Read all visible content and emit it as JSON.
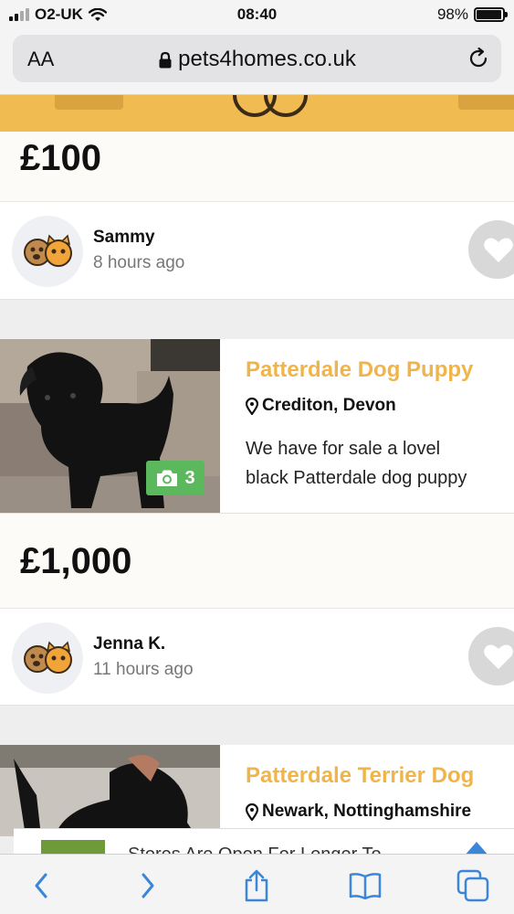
{
  "status_bar": {
    "carrier": "O2-UK",
    "time": "08:40",
    "battery": "98%",
    "battery_level": 0.98
  },
  "browser": {
    "text_size_label": "AA",
    "url": "pets4homes.co.uk"
  },
  "listings": [
    {
      "price": "£100",
      "seller": "Sammy",
      "posted": "8 hours ago"
    },
    {
      "title": "Patterdale Dog Puppy",
      "location": "Crediton, Devon",
      "description_lines": [
        "We have for sale a lovel",
        "black Patterdale dog puppy"
      ],
      "photo_count": "3",
      "price": "£1,000",
      "seller": "Jenna K.",
      "posted": "11 hours ago"
    },
    {
      "title": "Patterdale Terrier Dog",
      "location": "Newark, Nottinghamshire"
    }
  ],
  "ad": {
    "text": "Stores Are Open For Longer To"
  },
  "colors": {
    "accent": "#f0b54a",
    "header": "#f0bc52",
    "photo_badge": "#5cb85c",
    "ios_blue": "#3a86d8"
  }
}
